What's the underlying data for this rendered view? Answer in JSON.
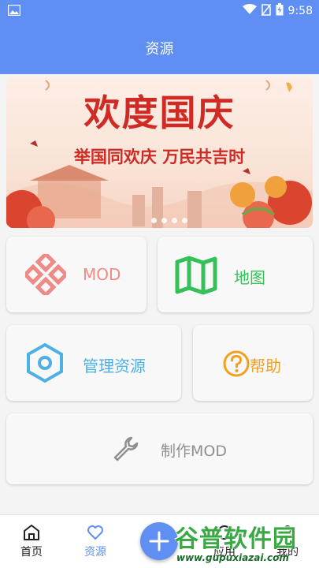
{
  "status_bar": {
    "time": "9:58"
  },
  "header": {
    "title": "资源"
  },
  "banner": {
    "title": "欢度国庆",
    "subtitle": "举国同欢庆 万民共吉时",
    "pages": 4,
    "active_page": 1
  },
  "cards": {
    "mod": {
      "label": "MOD",
      "color": "#ef8a86"
    },
    "map": {
      "label": "地图",
      "color": "#35c05a"
    },
    "manage": {
      "label": "管理资源",
      "color": "#4eb0e6"
    },
    "help": {
      "label": "帮助",
      "color": "#f2a01f"
    },
    "make_mod": {
      "label": "制作MOD",
      "color": "#8f8f8f"
    }
  },
  "bottom_nav": {
    "home": {
      "label": "首页"
    },
    "resources": {
      "label": "资源",
      "active_color": "#5f8ff2"
    },
    "apps": {
      "label": "应用"
    },
    "mine": {
      "label": "我的"
    }
  },
  "watermark": {
    "name": "谷普软件园",
    "url": "www.gupuxiazai.com"
  },
  "colors": {
    "primary": "#5f8ff2"
  }
}
